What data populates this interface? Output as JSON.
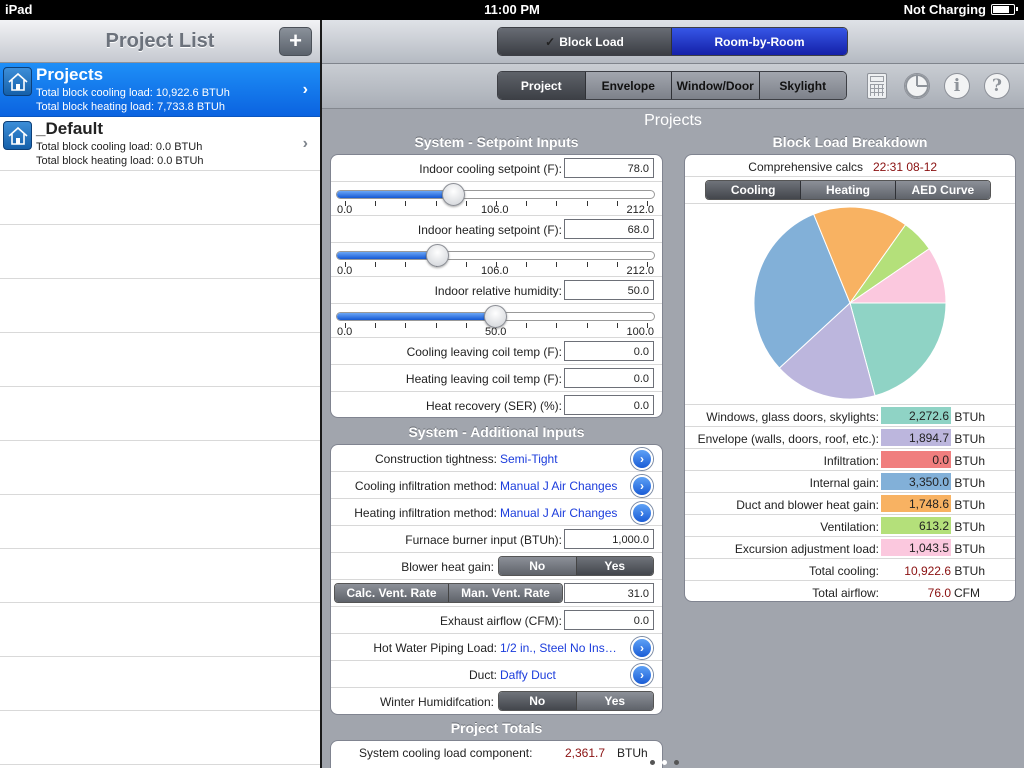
{
  "status": {
    "device": "iPad",
    "time": "11:00 PM",
    "battery_text": "Not Charging",
    "battery_level": 0.85
  },
  "left": {
    "title": "Project List",
    "add_label": "+",
    "projects": [
      {
        "name": "Projects",
        "cooling": "Total block cooling load: 10,922.6 BTUh",
        "heating": "Total block heating load: 7,733.8 BTUh",
        "selected": true
      },
      {
        "name": "_Default",
        "cooling": "Total block cooling load: 0.0 BTUh",
        "heating": "Total block heating load: 0.0 BTUh",
        "selected": false
      }
    ]
  },
  "header": {
    "mode_tabs": [
      "Block Load",
      "Room-by-Room"
    ],
    "mode_check": "✓",
    "section_tabs": [
      "Project",
      "Envelope",
      "Window/Door",
      "Skylight"
    ],
    "info_icon": "i",
    "help_icon": "?"
  },
  "content_title": "Projects",
  "setpoint": {
    "title": "System - Setpoint Inputs",
    "cooling_label": "Indoor cooling setpoint (F):",
    "cooling_value": "78.0",
    "cooling_slider": {
      "min": "0.0",
      "mid": "106.0",
      "max": "212.0",
      "fraction": 0.37
    },
    "heating_label": "Indoor heating setpoint (F):",
    "heating_value": "68.0",
    "heating_slider": {
      "min": "0.0",
      "mid": "106.0",
      "max": "212.0",
      "fraction": 0.32
    },
    "humidity_label": "Indoor relative humidity:",
    "humidity_value": "50.0",
    "humidity_slider": {
      "min": "0.0",
      "mid": "50.0",
      "max": "100.0",
      "fraction": 0.5
    },
    "rows": [
      {
        "label": "Cooling leaving coil temp (F):",
        "value": "0.0"
      },
      {
        "label": "Heating leaving coil temp (F):",
        "value": "0.0"
      },
      {
        "label": "Heat recovery (SER) (%):",
        "value": "0.0"
      }
    ]
  },
  "additional": {
    "title": "System - Additional Inputs",
    "tightness_label": "Construction tightness:",
    "tightness_value": "Semi-Tight",
    "cool_inf_label": "Cooling infiltration method:",
    "cool_inf_value": "Manual J Air Changes",
    "heat_inf_label": "Heating infiltration method:",
    "heat_inf_value": "Manual J Air Changes",
    "furnace_label": "Furnace burner input (BTUh):",
    "furnace_value": "1,000.0",
    "blower_label": "Blower heat gain:",
    "no": "No",
    "yes": "Yes",
    "calc_vent": "Calc. Vent. Rate",
    "man_vent": "Man. Vent. Rate",
    "vent_value": "31.0",
    "exhaust_label": "Exhaust airflow (CFM):",
    "exhaust_value": "0.0",
    "piping_label": "Hot Water Piping Load:",
    "piping_value": "1/2 in., Steel No Insulation",
    "duct_label": "Duct:",
    "duct_value": "Daffy Duct",
    "humid_label": "Winter Humidifcation:"
  },
  "totals": {
    "title": "Project Totals",
    "row_label": "System cooling load component:",
    "row_value": "2,361.7",
    "row_unit": "BTUh"
  },
  "breakdown": {
    "title": "Block Load Breakdown",
    "comp_label": "Comprehensive calcs",
    "comp_time": "22:31 08-12",
    "tabs": [
      "Cooling",
      "Heating",
      "AED Curve"
    ],
    "rows": [
      {
        "label": "Windows, glass doors, skylights:",
        "value": "2,272.6",
        "unit": "BTUh",
        "color": "#8fd3c5"
      },
      {
        "label": "Envelope (walls, doors, roof, etc.):",
        "value": "1,894.7",
        "unit": "BTUh",
        "color": "#bcb6dd"
      },
      {
        "label": "Infiltration:",
        "value": "0.0",
        "unit": "BTUh",
        "color": "#f07e7e"
      },
      {
        "label": "Internal gain:",
        "value": "3,350.0",
        "unit": "BTUh",
        "color": "#82b0d8"
      },
      {
        "label": "Duct and blower heat gain:",
        "value": "1,748.6",
        "unit": "BTUh",
        "color": "#f8b262"
      },
      {
        "label": "Ventilation:",
        "value": "613.2",
        "unit": "BTUh",
        "color": "#b4e07a"
      },
      {
        "label": "Excursion adjustment load:",
        "value": "1,043.5",
        "unit": "BTUh",
        "color": "#fbc8de"
      }
    ],
    "total_cooling_label": "Total cooling:",
    "total_cooling_value": "10,922.6",
    "total_cooling_unit": "BTUh",
    "total_airflow_label": "Total airflow:",
    "total_airflow_value": "76.0",
    "total_airflow_unit": "CFM"
  },
  "chart_data": {
    "type": "pie",
    "categories": [
      "Windows, glass doors, skylights",
      "Envelope (walls, doors, roof, etc.)",
      "Infiltration",
      "Internal gain",
      "Duct and blower heat gain",
      "Ventilation",
      "Excursion adjustment load"
    ],
    "values": [
      2272.6,
      1894.7,
      0.0,
      3350.0,
      1748.6,
      613.2,
      1043.5
    ],
    "colors": [
      "#8fd3c5",
      "#bcb6dd",
      "#f07e7e",
      "#82b0d8",
      "#f8b262",
      "#b4e07a",
      "#fbc8de"
    ]
  }
}
